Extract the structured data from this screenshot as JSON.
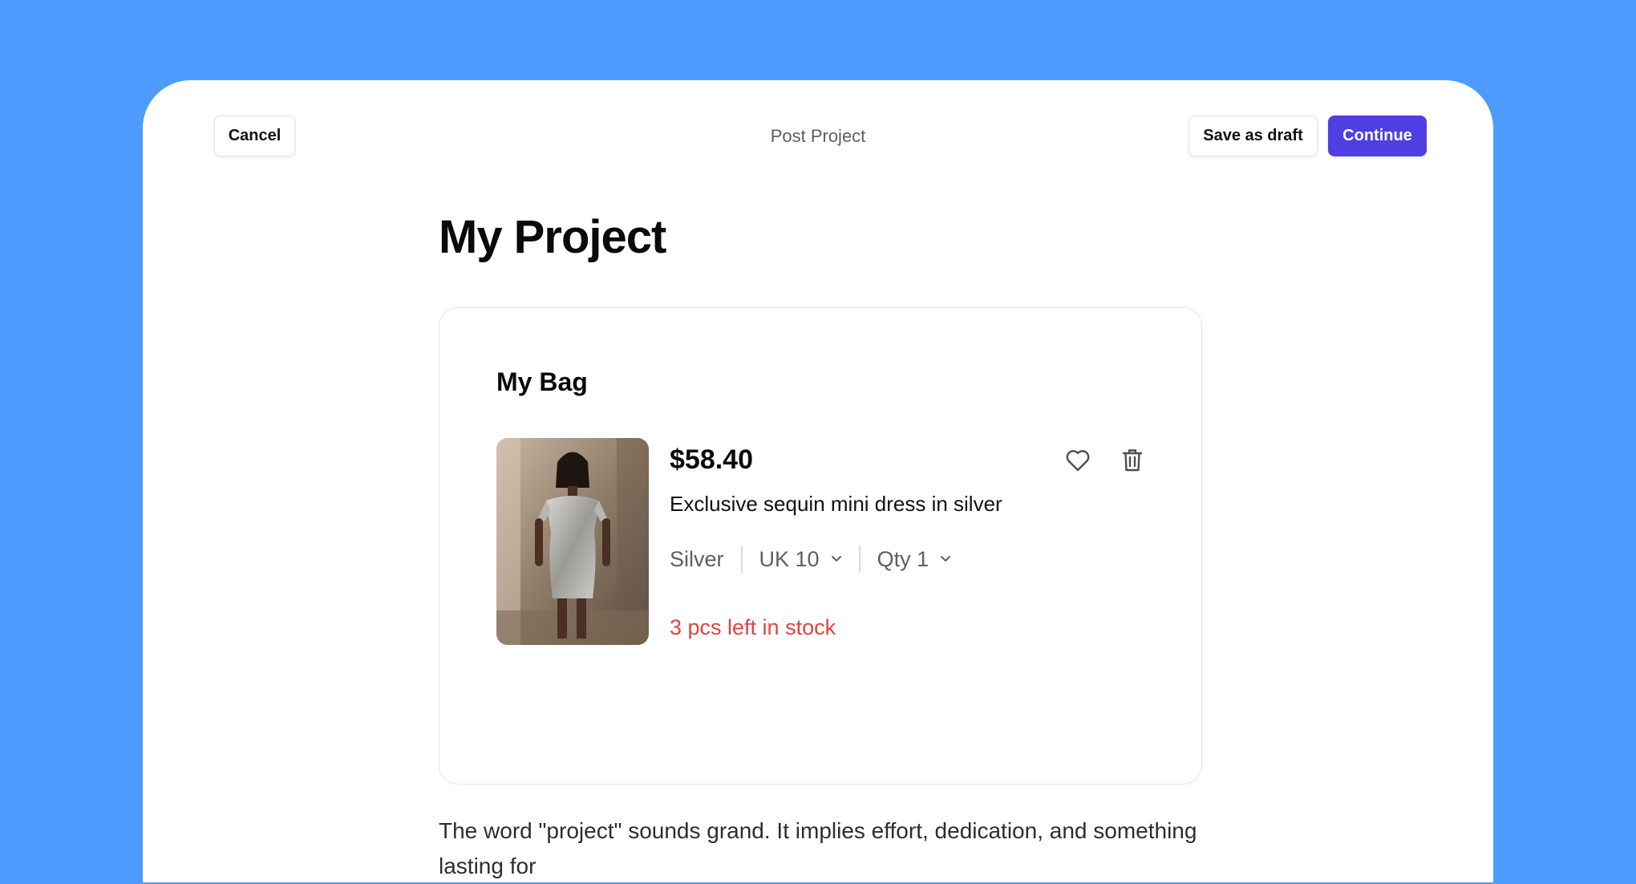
{
  "topbar": {
    "cancel_label": "Cancel",
    "title": "Post Project",
    "save_draft_label": "Save as draft",
    "continue_label": "Continue"
  },
  "page": {
    "title": "My Project"
  },
  "bag": {
    "title": "My Bag",
    "item": {
      "image_icon": "product-photo",
      "price": "$58.40",
      "name": "Exclusive sequin mini dress in silver",
      "color": "Silver",
      "size": "UK 10",
      "quantity": "Qty 1",
      "stock_notice": "3 pcs left in stock",
      "wishlist_icon": "heart-icon",
      "delete_icon": "trash-icon"
    }
  },
  "body": {
    "text": "The word \"project\" sounds grand. It implies effort, dedication, and something lasting for"
  },
  "colors": {
    "background": "#4d9cfd",
    "accent": "#4f3fe3",
    "stock_warning": "#e0433e"
  }
}
